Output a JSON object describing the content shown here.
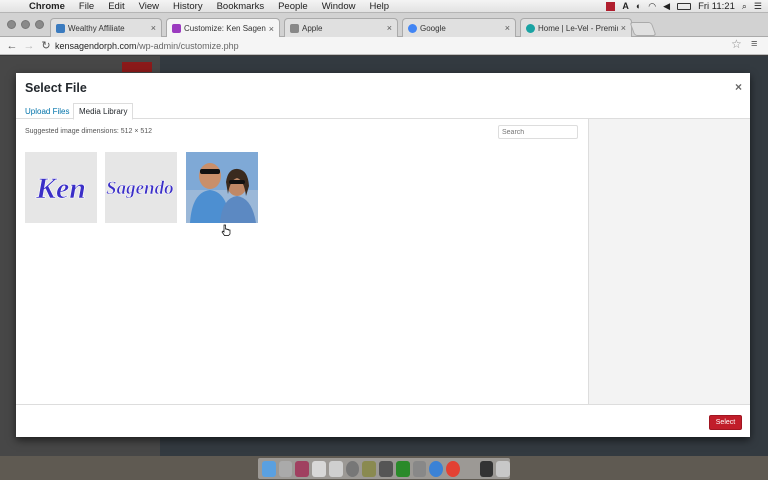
{
  "menubar": {
    "apple_icon": "apple-logo-icon",
    "items": [
      "Chrome",
      "File",
      "Edit",
      "View",
      "History",
      "Bookmarks",
      "People",
      "Window",
      "Help"
    ],
    "clock": "Fri 11:21"
  },
  "tabs": [
    {
      "label": "Wealthy Affiliate",
      "favicon_color": "#3b7bbf",
      "active": false
    },
    {
      "label": "Customize: Ken Sagendorph",
      "favicon_color": "#9b3bbf",
      "active": true
    },
    {
      "label": "Apple",
      "favicon_color": "#888888",
      "active": false
    },
    {
      "label": "Google",
      "favicon_color": "#4285f4",
      "active": false
    },
    {
      "label": "Home | Le-Vel - Premium",
      "favicon_color": "#1aa3a3",
      "active": false
    }
  ],
  "address": {
    "host": "kensagendorph.com",
    "path": "/wp-admin/customize.php"
  },
  "modal": {
    "title": "Select File",
    "close_label": "×",
    "tabs": [
      "Upload Files",
      "Media Library"
    ],
    "suggested": "Suggested image dimensions: 512 × 512",
    "search_placeholder": "Search",
    "select_label": "Select",
    "thumbnails": [
      {
        "text": "Ken",
        "kind": "text-logo"
      },
      {
        "text": "Sagendo",
        "kind": "text-logo"
      },
      {
        "kind": "photo"
      }
    ]
  },
  "colors": {
    "accent_blue": "#0073aa",
    "select_red": "#c11d2a",
    "logo_purple": "#3b2fc7"
  }
}
